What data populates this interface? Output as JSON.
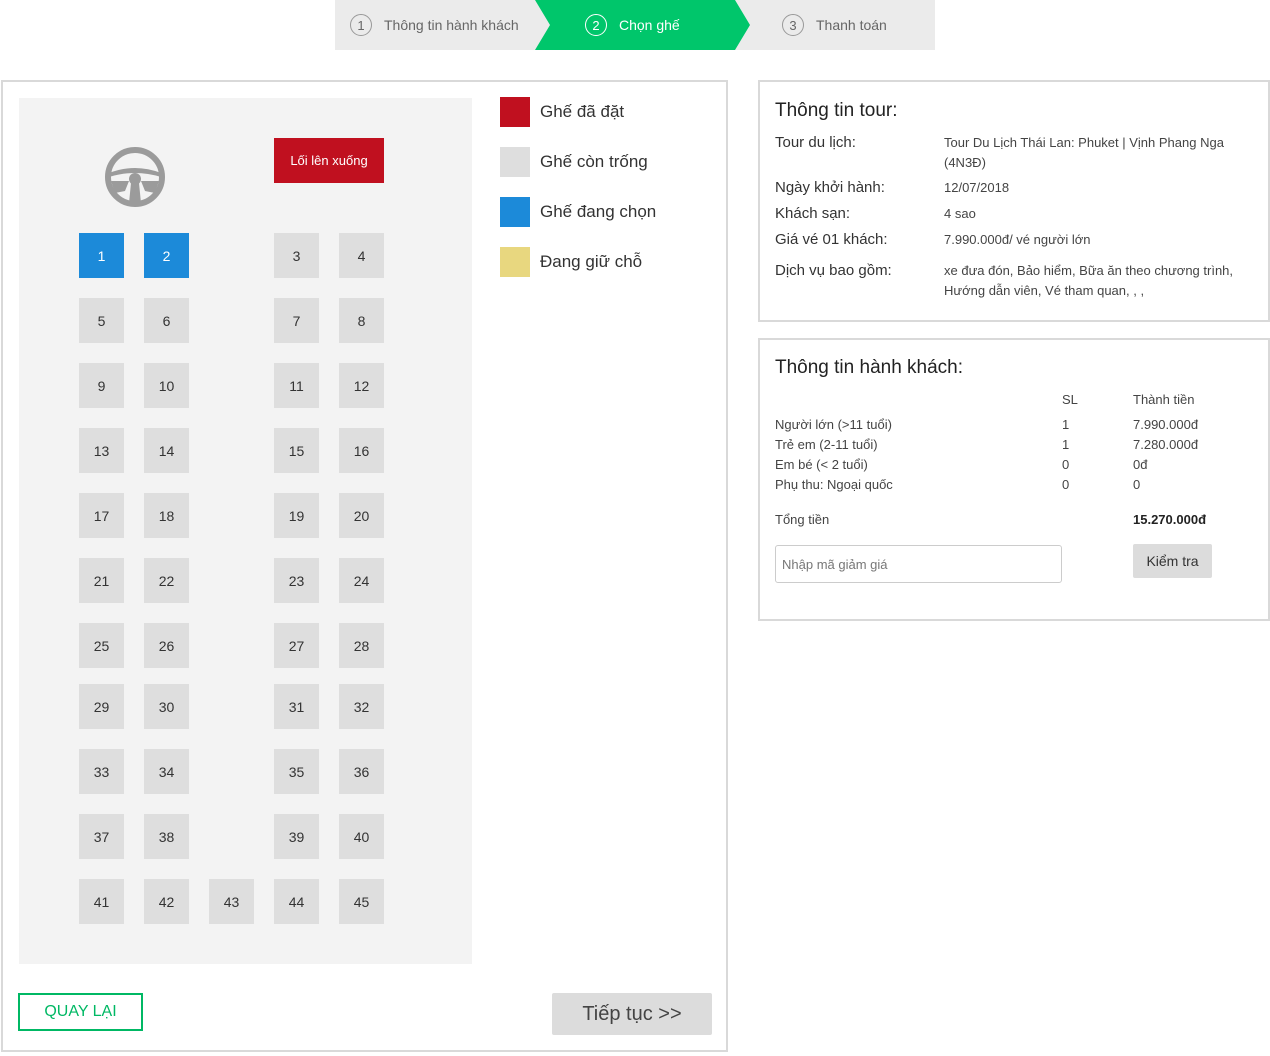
{
  "steps": [
    {
      "num": "1",
      "label": "Thông tin hành khách"
    },
    {
      "num": "2",
      "label": "Chọn ghế"
    },
    {
      "num": "3",
      "label": "Thanh toán"
    }
  ],
  "bus": {
    "door_label": "Lối lên xuống",
    "seats": [
      "1",
      "2",
      "3",
      "4",
      "5",
      "6",
      "7",
      "8",
      "9",
      "10",
      "11",
      "12",
      "13",
      "14",
      "15",
      "16",
      "17",
      "18",
      "19",
      "20",
      "21",
      "22",
      "23",
      "24",
      "25",
      "26",
      "27",
      "28",
      "29",
      "30",
      "31",
      "32",
      "33",
      "34",
      "35",
      "36",
      "37",
      "38",
      "39",
      "40",
      "41",
      "42",
      "43",
      "44",
      "45"
    ],
    "selected_seats": [
      "1",
      "2"
    ]
  },
  "legend": [
    {
      "label": "Ghế đã đặt",
      "color": "#c0101f"
    },
    {
      "label": "Ghế còn trống",
      "color": "#dedede"
    },
    {
      "label": "Ghế đang chọn",
      "color": "#1c8ad9"
    },
    {
      "label": "Đang giữ chỗ",
      "color": "#e8d77f"
    }
  ],
  "buttons": {
    "back": "QUAY LẠI",
    "next": "Tiếp tục >>",
    "check": "Kiểm tra"
  },
  "tour_info": {
    "title": "Thông tin tour:",
    "rows": [
      {
        "label": "Tour du lịch:",
        "value": "Tour Du Lịch Thái Lan: Phuket | Vịnh Phang Nga (4N3Đ)"
      },
      {
        "label": "Ngày khởi hành:",
        "value": "12/07/2018"
      },
      {
        "label": "Khách sạn:",
        "value": "4 sao"
      },
      {
        "label": "Giá vé 01 khách:",
        "value": "7.990.000đ/ vé người lớn"
      },
      {
        "label": "Dịch vụ bao gồm:",
        "value": "xe đưa đón, Bảo hiểm, Bữa ăn theo chương trình, Hướng dẫn viên, Vé tham quan, , ,"
      }
    ]
  },
  "passenger_info": {
    "title": "Thông tin hành khách:",
    "col_qty": "SL",
    "col_amount": "Thành tiền",
    "rows": [
      {
        "label": "Người lớn (>11 tuổi)",
        "qty": "1",
        "amount": "7.990.000đ"
      },
      {
        "label": "Trẻ em (2-11 tuổi)",
        "qty": "1",
        "amount": "7.280.000đ"
      },
      {
        "label": "Em bé (< 2 tuổi)",
        "qty": "0",
        "amount": "0đ"
      },
      {
        "label": "Phụ thu: Ngoại quốc",
        "qty": "0",
        "amount": "0"
      }
    ],
    "total_label": "Tổng tiền",
    "total_value": "15.270.000đ",
    "promo_placeholder": "Nhập mã giảm giá"
  }
}
